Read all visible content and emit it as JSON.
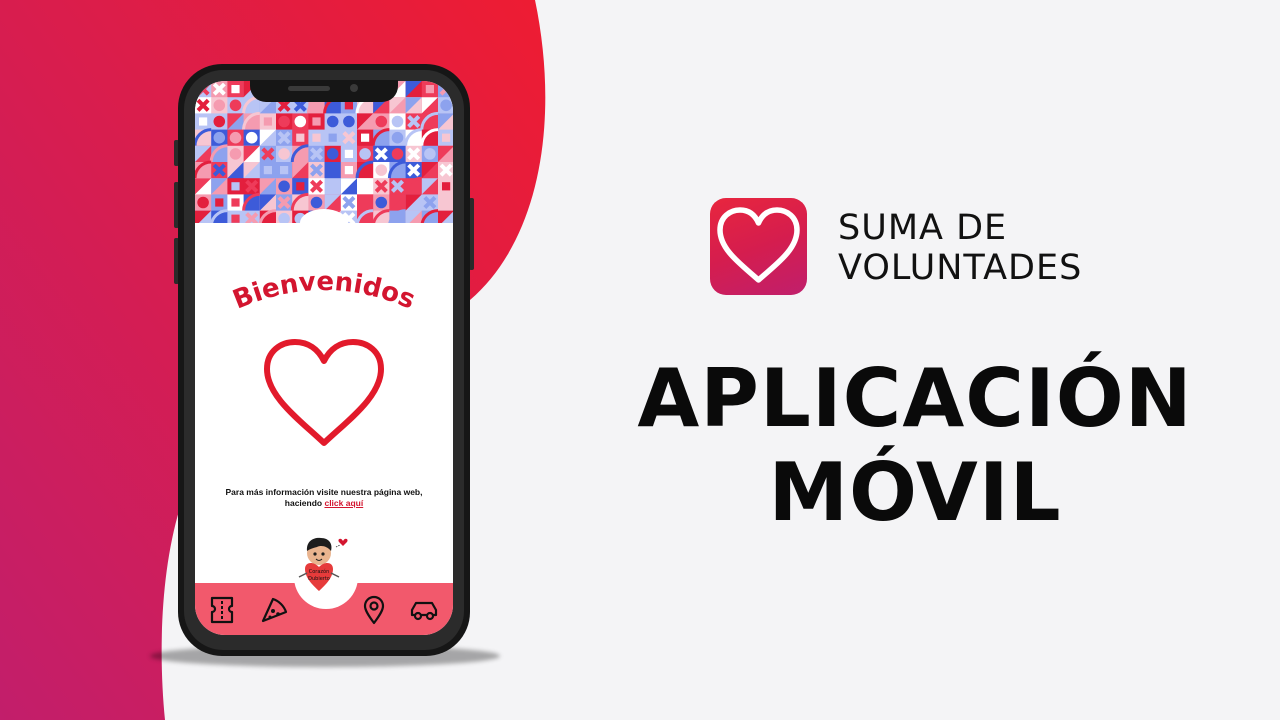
{
  "colors": {
    "background": "#f4f4f6",
    "gradient_start": "#c21e6b",
    "gradient_end": "#ee1c32",
    "accent_red": "#d3152f",
    "nav_bar": "#f2596c",
    "text_dark": "#0a0a0a"
  },
  "brand": {
    "line1": "SUMA DE",
    "line2": "VOLUNTADES",
    "logo_icon": "heart-icon"
  },
  "headline": {
    "line1": "APLICACIÓN",
    "line2": "MÓVIL"
  },
  "phone_screen": {
    "welcome_text": "Bienvenidos",
    "info_text": "Para más información visite nuestra página web, haciendo",
    "info_link": "click aquí",
    "mascot_badge_line1": "Corazón",
    "mascot_badge_line2": "Dubierto",
    "nav_items": [
      {
        "icon": "ticket-icon"
      },
      {
        "icon": "pizza-icon"
      },
      {
        "icon": "location-pin-icon"
      },
      {
        "icon": "car-icon"
      }
    ]
  }
}
